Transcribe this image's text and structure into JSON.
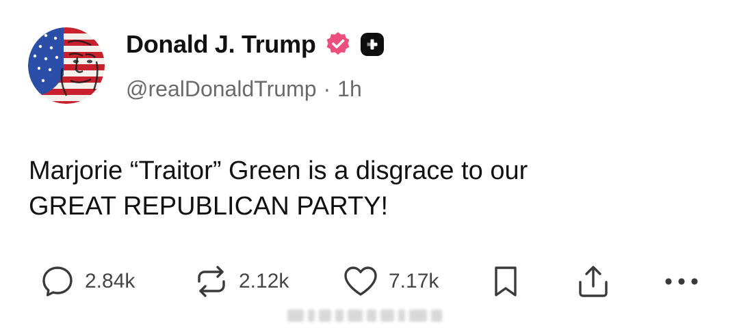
{
  "post": {
    "author": {
      "display_name": "Donald J. Trump",
      "handle": "@realDonaldTrump",
      "separator": "·",
      "time_ago": "1h",
      "verified_badge_icon": "verified-badge-icon",
      "plus_badge_icon": "plus-badge-icon"
    },
    "text": "Marjorie “Traitor” Green is a disgrace to our\nGREAT REPUBLICAN PARTY!",
    "actions": {
      "reply_count": "2.84k",
      "repost_count": "2.12k",
      "like_count": "7.17k"
    },
    "colors": {
      "verified_badge": "#ec4f7e",
      "text_primary": "#111111",
      "text_secondary": "#6a6a6a",
      "icon": "#3a3a3a"
    }
  }
}
